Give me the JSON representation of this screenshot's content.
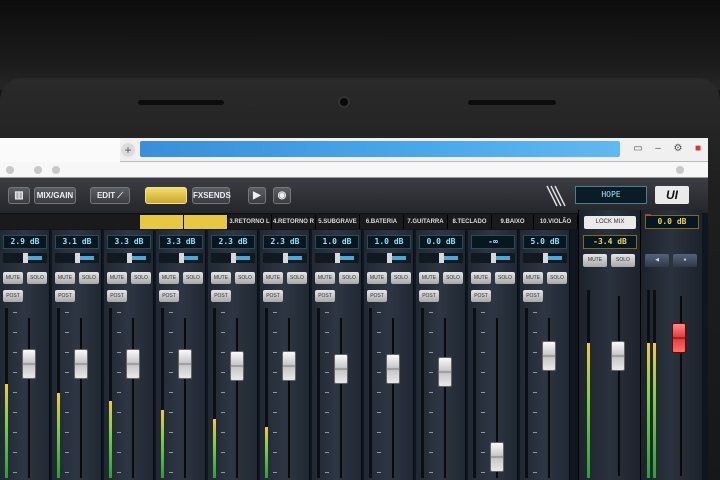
{
  "toolbar": {
    "buttons": [
      {
        "label": "",
        "icon": "bars-icon"
      },
      {
        "label": "MIX/GAIN"
      },
      {
        "label": "EDIT",
        "icon": "edit-icon"
      },
      {
        "label": "",
        "active": true
      },
      {
        "label": "FXSENDS"
      },
      {
        "label": "",
        "icon": "play-icon"
      },
      {
        "label": "",
        "icon": "record-icon"
      }
    ],
    "scene_name": "HOPE",
    "logo": "UI"
  },
  "channel_names": [
    "",
    "",
    "3.RETORNO L",
    "4.RETORNO R",
    "5.SUBGRAVE",
    "6.BATERIA",
    "7.GUITARRA",
    "8.TECLADO",
    "9.BAIXO",
    "10.VIOLÃO"
  ],
  "channels": [
    {
      "gain": "2.9 dB",
      "fader_level": 0.76,
      "meter_level": 0.55
    },
    {
      "gain": "3.1 dB",
      "fader_level": 0.76,
      "meter_level": 0.5
    },
    {
      "gain": "3.3 dB",
      "fader_level": 0.76,
      "meter_level": 0.45
    },
    {
      "gain": "3.3 dB",
      "fader_level": 0.76,
      "meter_level": 0.4
    },
    {
      "gain": "2.3 dB",
      "fader_level": 0.75,
      "meter_level": 0.35
    },
    {
      "gain": "2.3 dB",
      "fader_level": 0.75,
      "meter_level": 0.3
    },
    {
      "gain": "1.0 dB",
      "fader_level": 0.72,
      "meter_level": 0.0
    },
    {
      "gain": "1.0 dB",
      "fader_level": 0.72,
      "meter_level": 0.0
    },
    {
      "gain": "0.0 dB",
      "fader_level": 0.7,
      "meter_level": 0.0
    },
    {
      "gain": "-∞",
      "fader_level": 0.05,
      "meter_level": 0.0
    },
    {
      "gain": "5.0 dB",
      "fader_level": 0.82,
      "meter_level": 0.0
    }
  ],
  "strip_buttons": {
    "mute": "MUTE",
    "solo": "SOLO",
    "post": "POST PROC"
  },
  "master": {
    "label_left": "LOCK MIX",
    "gain_left": "-3.4 dB",
    "gain_right": "0.0 dB",
    "mute": "MUTE",
    "solo": "SOLO",
    "fader_left_level": 0.7,
    "fader_right_level": 0.82,
    "meter_level": 0.72
  },
  "colors": {
    "accent_yellow": "#e8c83e",
    "gain_cyan": "#8fe0ff",
    "url_blue": "#3a8fd8"
  }
}
